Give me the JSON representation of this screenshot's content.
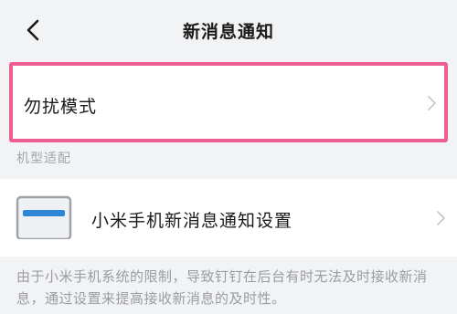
{
  "header": {
    "title": "新消息通知",
    "back_icon": "chevron-left-icon"
  },
  "dnd_row": {
    "label": "勿扰模式",
    "chevron_icon": "chevron-right-icon",
    "highlight_color": "#ec5f90"
  },
  "section": {
    "header": "机型适配"
  },
  "device_row": {
    "icon": "phone-notification-icon",
    "label": "小米手机新消息通知设置",
    "chevron_icon": "chevron-right-icon",
    "icon_accent": "#2f86d6"
  },
  "footer": {
    "note": "由于小米手机系统的限制，导致钉钉在后台有时无法及时接收新消息，通过设置来提高接收新消息的及时性。"
  }
}
